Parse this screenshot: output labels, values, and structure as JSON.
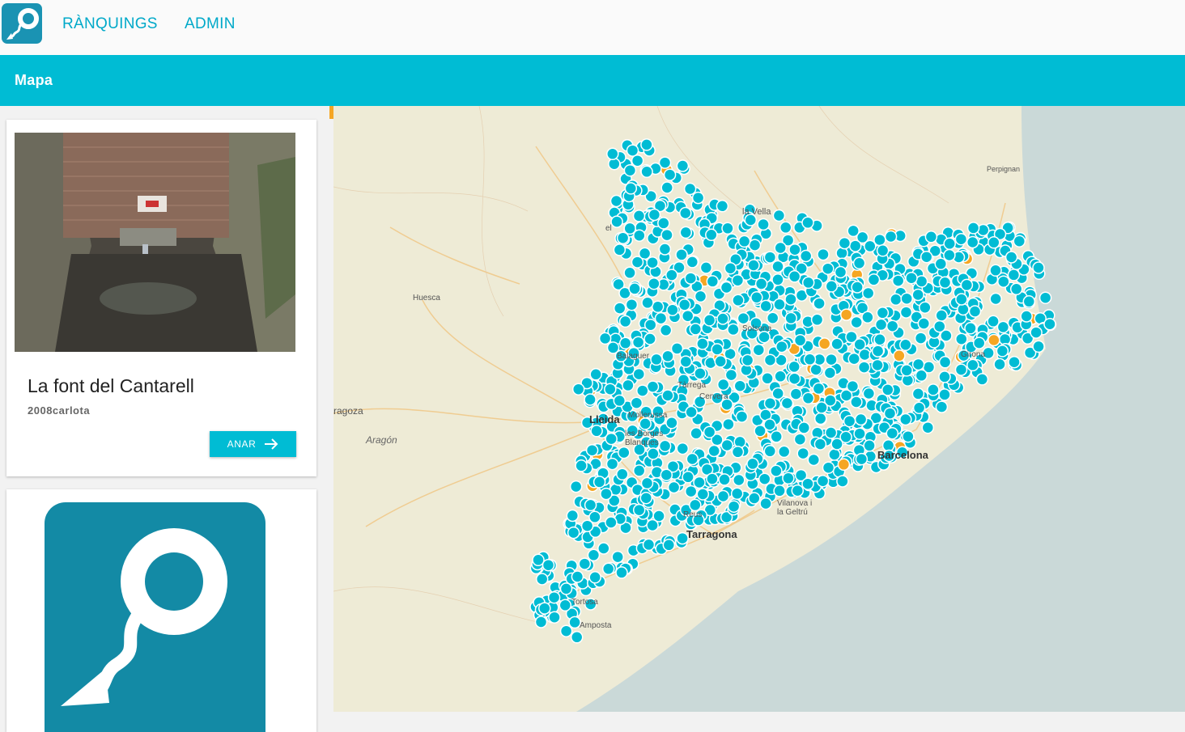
{
  "header": {
    "nav": [
      "RÀNQUINGS",
      "ADMIN"
    ]
  },
  "toolbar": {
    "title": "Mapa"
  },
  "card": {
    "title": "La font del Cantarell",
    "author": "2008carlota",
    "button_label": "ANAR"
  },
  "map": {
    "labels": {
      "vella": "la Vella",
      "perpignan": "Perpignan",
      "huesca": "Huesca",
      "saragossa": "ragoza",
      "arago": "Aragón",
      "lleida": "Lleida",
      "mollerussa": "Mollerussa",
      "borges": "les Borges Blanques",
      "balaguer": "Balaguer",
      "solsona": "Solsona",
      "cervera": "Cervera",
      "tarrega": "Tàrrega",
      "reus": "Reus",
      "tarragona": "Tarragona",
      "vilanova": "Vilanova i la Geltrú",
      "barcelona": "Barcelona",
      "girona": "Girona",
      "tortosa": "Tortosa",
      "amposta": "Amposta",
      "el": "el"
    },
    "colors": {
      "marker": "#00bcd4",
      "marker_alt": "#f5a623",
      "sea": "#cad9d8",
      "land": "#eeebd6"
    }
  }
}
